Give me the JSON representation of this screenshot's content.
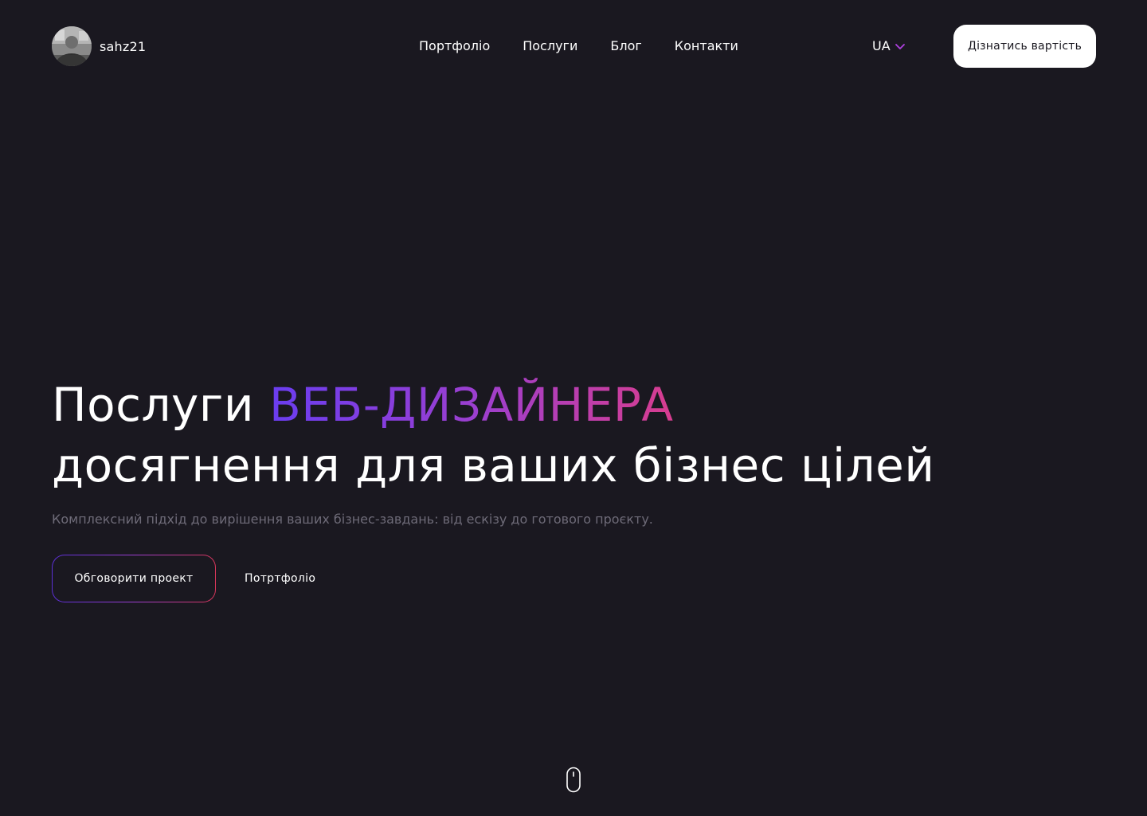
{
  "header": {
    "logo_text": "sahz21",
    "nav": [
      {
        "label": "Портфоліо"
      },
      {
        "label": "Послуги"
      },
      {
        "label": "Блог"
      },
      {
        "label": "Контакти"
      }
    ],
    "language": {
      "selected": "UA",
      "icon": "chevron-down-icon"
    },
    "cta_label": "Дізнатись вартість"
  },
  "hero": {
    "title_prefix": "Послуги",
    "title_accent": "ВЕБ-ДИЗАЙНЕРА",
    "title_line2": "досягнення для ваших бізнес цілей",
    "subtitle": "Комплексний підхід до вирішення ваших бізнес-завдань: від ескізу до готового проєкту.",
    "primary_button": "Обговорити проект",
    "secondary_button": "Потртфоліо"
  },
  "colors": {
    "background": "#1a1820",
    "accent_start": "#6a3df0",
    "accent_end": "#d83d8f",
    "text": "#ffffff",
    "muted_text": "#6e6b78"
  },
  "icons": {
    "scroll": "mouse-scroll-icon",
    "avatar": "avatar"
  }
}
